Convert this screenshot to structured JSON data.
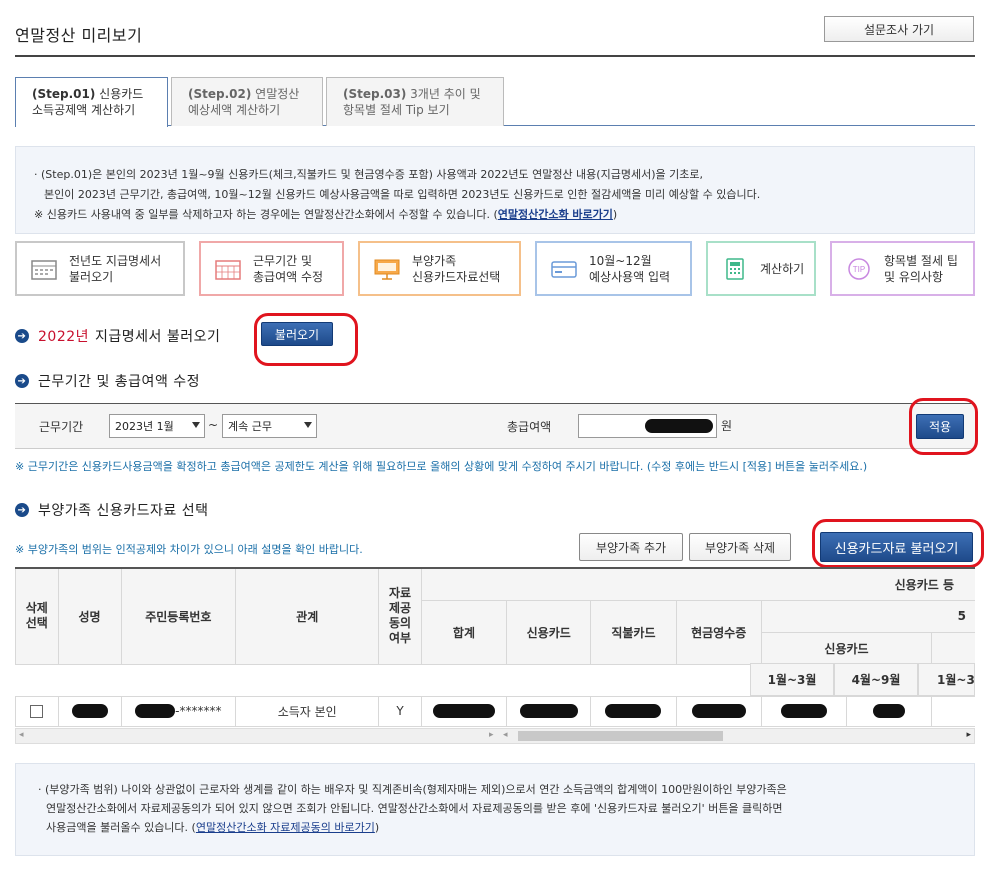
{
  "page": {
    "title": "연말정산 미리보기",
    "survey_button": "설문조사 가기"
  },
  "tabs": [
    {
      "step": "(Step.01)",
      "line1": "신용카드",
      "line2": "소득공제액 계산하기"
    },
    {
      "step": "(Step.02)",
      "line1": "연말정산",
      "line2": "예상세액 계산하기"
    },
    {
      "step": "(Step.03)",
      "line1": "3개년 추이 및",
      "line2": "항목별 절세 Tip 보기"
    }
  ],
  "info": {
    "line1": "· (Step.01)은 본인의 2023년 1월~9월 신용카드(체크,직불카드 및 현금영수증 포함) 사용액과 2022년도 연말정산 내용(지급명세서)을 기초로,",
    "line2": "본인이 2023년 근무기간, 총급여액, 10월~12월 신용카드 예상사용금액을 따로 입력하면 2023년도 신용카드로 인한 절감세액을 미리 예상할 수 있습니다.",
    "line3": "※ 신용카드 사용내역 중 일부를 삭제하고자 하는 경우에는 연말정산간소화에서 수정할 수 있습니다. (",
    "line3_link": "연말정산간소화 바로가기",
    "line3_end": ")"
  },
  "steps": [
    {
      "line1": "전년도 지급명세서",
      "line2": "불러오기",
      "icon": "calendar-icon",
      "color": "#bbbbbb"
    },
    {
      "line1": "근무기간 및",
      "line2": "총급여액 수정",
      "icon": "calendar-grid-icon",
      "color": "#f0a0a0"
    },
    {
      "line1": "부양가족",
      "line2": "신용카드자료선택",
      "icon": "presentation-icon",
      "color": "#f5c08a"
    },
    {
      "line1": "10월~12월",
      "line2": "예상사용액 입력",
      "icon": "card-icon",
      "color": "#a8c4e8"
    },
    {
      "line1": "계산하기",
      "line2": "",
      "icon": "calculator-icon",
      "color": "#a8e0c8"
    },
    {
      "line1": "항목별 절세 팁",
      "line2": "및 유의사항",
      "icon": "tip-icon",
      "color": "#d8b0e8"
    }
  ],
  "section1": {
    "year": "2022년",
    "title": "지급명세서 불러오기",
    "button": "불러오기"
  },
  "section2": {
    "title": "근무기간 및 총급여액 수정",
    "period_label": "근무기간",
    "period_start": "2023년 1월",
    "tilde": "~",
    "period_end": "계속 근무",
    "salary_label": "총급여액",
    "salary_unit": "원",
    "apply_button": "적용",
    "note": "※ 근무기간은 신용카드사용금액을 확정하고 총급여액은 공제한도 계산을 위해 필요하므로 올해의 상황에 맞게 수정하여 주시기 바랍니다. (수정 후에는 반드시 [적용] 버튼을 눌러주세요.)"
  },
  "section3": {
    "title": "부양가족 신용카드자료 선택",
    "note": "※ 부양가족의 범위는 인적공제와 차이가 있으니 아래 설명을 확인 바랍니다.",
    "add_button": "부양가족 추가",
    "delete_button": "부양가족 삭제",
    "load_button": "신용카드자료 불러오기"
  },
  "table": {
    "headers": {
      "delete": "삭제\n선택",
      "name": "성명",
      "rrn": "주민등록번호",
      "relation": "관계",
      "consent": "자료\n제공\n동의\n여부",
      "card_group": "신용카드 등",
      "total": "합계",
      "credit": "신용카드",
      "debit": "직불카드",
      "cash": "현금영수증",
      "sub5": "5",
      "credit2": "신용카드",
      "m13": "1월~3월",
      "m49": "4월~9월",
      "m13b": "1월~3"
    },
    "row": {
      "rrn_suffix": "-*******",
      "relation": "소득자 본인",
      "consent": "Y"
    }
  },
  "bottom": {
    "line1": "· (부양가족 범위) 나이와 상관없이 근로자와 생계를 같이 하는 배우자 및 직계존비속(형제자매는 제외)으로서 연간 소득금액의 합계액이 100만원이하인 부양가족은",
    "line2": "연말정산간소화에서 자료제공동의가 되어 있지 않으면 조회가 안됩니다. 연말정산간소화에서 자료제공동의를 받은 후에 '신용카드자료 불러오기' 버튼을 클릭하면",
    "line3": "사용금액을 불러올수 있습니다. (",
    "line3_link": "연말정산간소화 자료제공동의 바로가기",
    "line3_end": ")"
  }
}
